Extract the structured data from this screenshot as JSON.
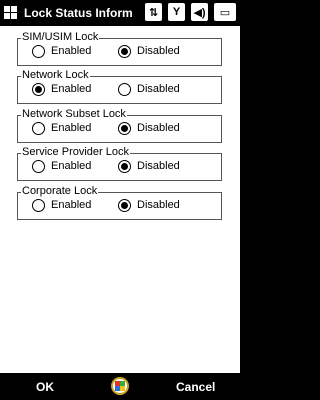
{
  "titlebar": {
    "title": "Lock Status Inform",
    "icons": [
      "windows-start-icon",
      "network-icon",
      "signal-icon",
      "volume-icon",
      "battery-icon"
    ]
  },
  "groups": [
    {
      "label": "SIM/USIM Lock",
      "enabled_label": "Enabled",
      "disabled_label": "Disabled",
      "selected": "disabled"
    },
    {
      "label": "Network Lock",
      "enabled_label": "Enabled",
      "disabled_label": "Disabled",
      "selected": "enabled"
    },
    {
      "label": "Network Subset Lock",
      "enabled_label": "Enabled",
      "disabled_label": "Disabled",
      "selected": "disabled"
    },
    {
      "label": "Service Provider Lock",
      "enabled_label": "Enabled",
      "disabled_label": "Disabled",
      "selected": "disabled"
    },
    {
      "label": "Corporate Lock",
      "enabled_label": "Enabled",
      "disabled_label": "Disabled",
      "selected": "disabled"
    }
  ],
  "softkeys": {
    "left": "OK",
    "right": "Cancel",
    "center_icon": "input-method-icon"
  }
}
